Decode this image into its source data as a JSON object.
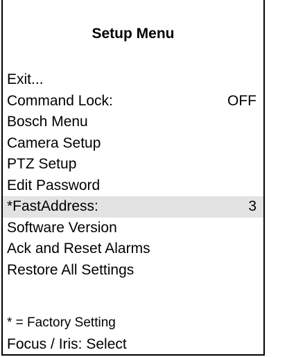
{
  "title": "Setup Menu",
  "menu": {
    "items": [
      {
        "label": "Exit...",
        "value": ""
      },
      {
        "label": "Command Lock:",
        "value": "OFF"
      },
      {
        "label": "Bosch Menu",
        "value": ""
      },
      {
        "label": "Camera Setup",
        "value": ""
      },
      {
        "label": "PTZ Setup",
        "value": ""
      },
      {
        "label": "Edit Password",
        "value": ""
      },
      {
        "label": "*FastAddress:",
        "value": "3"
      },
      {
        "label": "Software Version",
        "value": ""
      },
      {
        "label": "Ack and Reset Alarms",
        "value": ""
      },
      {
        "label": "Restore All Settings",
        "value": ""
      }
    ],
    "highlighted_index": 6,
    "highlight_color": "#e3e3e3"
  },
  "footer": {
    "factory_note": "* = Factory Setting",
    "focus_hint": "Focus / Iris: Select"
  }
}
